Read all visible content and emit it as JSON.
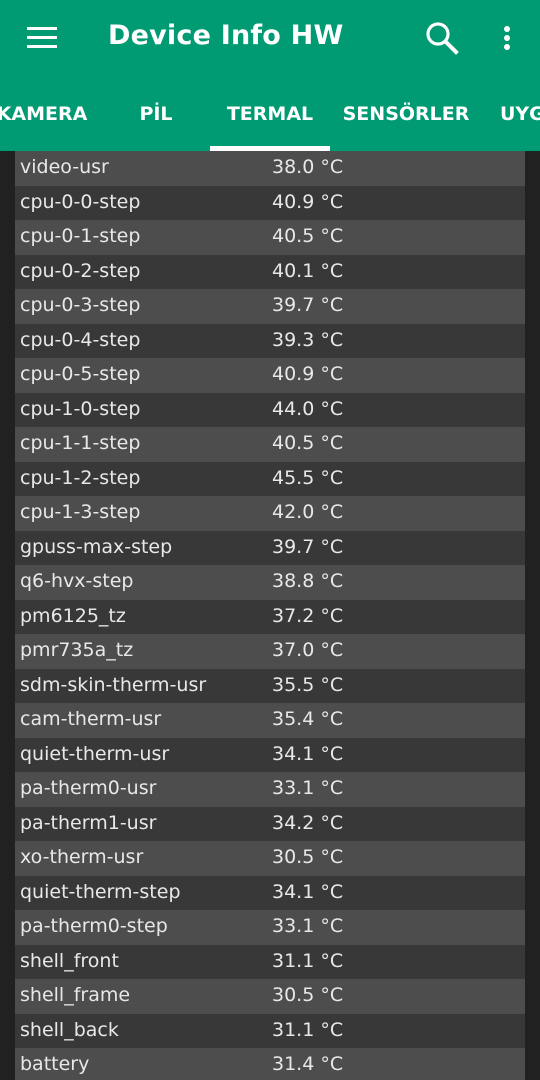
{
  "app": {
    "title": "Device Info HW",
    "icons": {
      "menu": "menu-icon",
      "search": "search-icon",
      "more": "more-vert-icon"
    },
    "colors": {
      "primary": "#009b72",
      "background": "#212121",
      "row_light": "#4d4d4d",
      "row_dark": "#383838",
      "text": "#e8e8e8"
    }
  },
  "tabs": [
    {
      "label": "KAMERA",
      "active": false
    },
    {
      "label": "PİL",
      "active": false
    },
    {
      "label": "TERMAL",
      "active": true
    },
    {
      "label": "SENSÖRLER",
      "active": false
    },
    {
      "label": "UYG",
      "active": false
    }
  ],
  "thermal": {
    "rows": [
      {
        "name": "video-usr",
        "value": "38.0 °C"
      },
      {
        "name": "cpu-0-0-step",
        "value": "40.9 °C"
      },
      {
        "name": "cpu-0-1-step",
        "value": "40.5 °C"
      },
      {
        "name": "cpu-0-2-step",
        "value": "40.1 °C"
      },
      {
        "name": "cpu-0-3-step",
        "value": "39.7 °C"
      },
      {
        "name": "cpu-0-4-step",
        "value": "39.3 °C"
      },
      {
        "name": "cpu-0-5-step",
        "value": "40.9 °C"
      },
      {
        "name": "cpu-1-0-step",
        "value": "44.0 °C"
      },
      {
        "name": "cpu-1-1-step",
        "value": "40.5 °C"
      },
      {
        "name": "cpu-1-2-step",
        "value": "45.5 °C"
      },
      {
        "name": "cpu-1-3-step",
        "value": "42.0 °C"
      },
      {
        "name": "gpuss-max-step",
        "value": "39.7 °C"
      },
      {
        "name": "q6-hvx-step",
        "value": "38.8 °C"
      },
      {
        "name": "pm6125_tz",
        "value": "37.2 °C"
      },
      {
        "name": "pmr735a_tz",
        "value": "37.0 °C"
      },
      {
        "name": "sdm-skin-therm-usr",
        "value": "35.5 °C"
      },
      {
        "name": "cam-therm-usr",
        "value": "35.4 °C"
      },
      {
        "name": "quiet-therm-usr",
        "value": "34.1 °C"
      },
      {
        "name": "pa-therm0-usr",
        "value": "33.1 °C"
      },
      {
        "name": "pa-therm1-usr",
        "value": "34.2 °C"
      },
      {
        "name": "xo-therm-usr",
        "value": "30.5 °C"
      },
      {
        "name": "quiet-therm-step",
        "value": "34.1 °C"
      },
      {
        "name": "pa-therm0-step",
        "value": "33.1 °C"
      },
      {
        "name": "shell_front",
        "value": "31.1 °C"
      },
      {
        "name": "shell_frame",
        "value": "30.5 °C"
      },
      {
        "name": "shell_back",
        "value": "31.1 °C"
      },
      {
        "name": "battery",
        "value": "31.4 °C"
      }
    ]
  }
}
